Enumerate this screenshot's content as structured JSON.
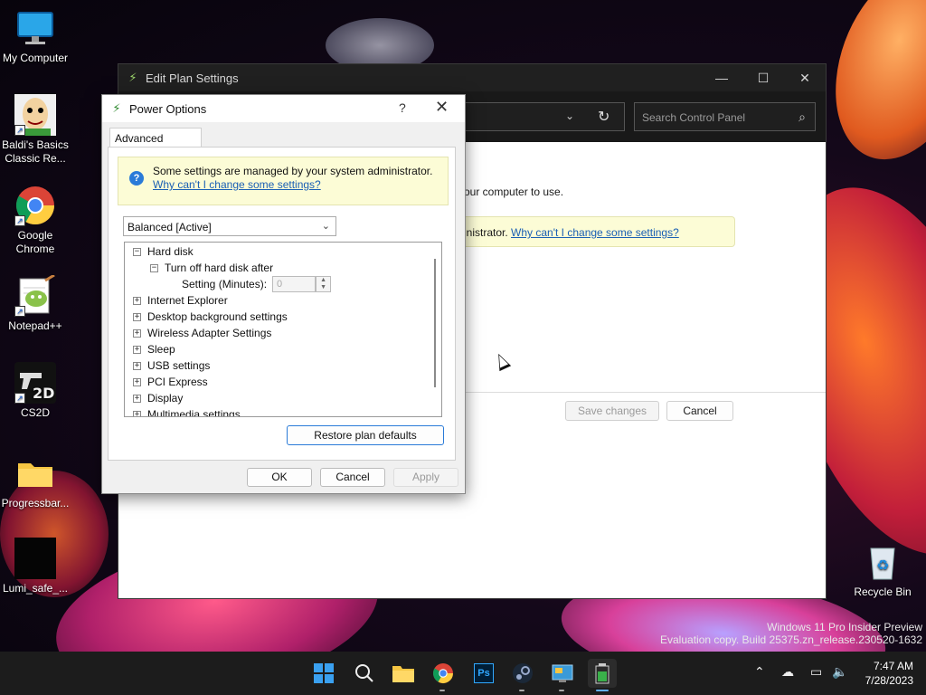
{
  "desktop": {
    "icons": [
      {
        "label": "My Computer"
      },
      {
        "label": "Baldi's Basics Classic Re..."
      },
      {
        "label": "Google Chrome"
      },
      {
        "label": "Notepad++"
      },
      {
        "label": "CS2D"
      },
      {
        "label": "Progressbar..."
      },
      {
        "label": "Lumi_safe_..."
      },
      {
        "label": "Recycle Bin"
      }
    ],
    "watermark": {
      "line1": "Windows 11 Pro Insider Preview",
      "line2": "Evaluation copy. Build 25375.zn_release.230520-1632"
    }
  },
  "back_window": {
    "title": "Edit Plan Settings",
    "controls": {
      "minimize": "—",
      "maximize": "☐",
      "close": "✕"
    },
    "search_placeholder": "Search Control Panel",
    "body_text": "our computer to use.",
    "admin_text": "inistrator.",
    "admin_link": "Why can't I change some settings?",
    "save_label": "Save changes",
    "cancel_label": "Cancel"
  },
  "dialog": {
    "title": "Power Options",
    "help": "?",
    "close": "✕",
    "tab_label": "Advanced settings",
    "info_text": "Some settings are managed by your system administrator.",
    "info_link": "Why can't I change some settings?",
    "plan": "Balanced [Active]",
    "tree": {
      "hard_disk": "Hard disk",
      "turn_off": "Turn off hard disk after",
      "setting_label": "Setting (Minutes):",
      "setting_value": "0",
      "internet_explorer": "Internet Explorer",
      "desktop_bg": "Desktop background settings",
      "wireless": "Wireless Adapter Settings",
      "sleep": "Sleep",
      "usb": "USB settings",
      "pci": "PCI Express",
      "display": "Display",
      "multimedia": "Multimedia settings"
    },
    "restore_label": "Restore plan defaults",
    "ok_label": "OK",
    "cancel_label": "Cancel",
    "apply_label": "Apply"
  },
  "taskbar": {
    "time": "7:47 AM",
    "date": "7/28/2023",
    "ps_label": "Ps"
  }
}
